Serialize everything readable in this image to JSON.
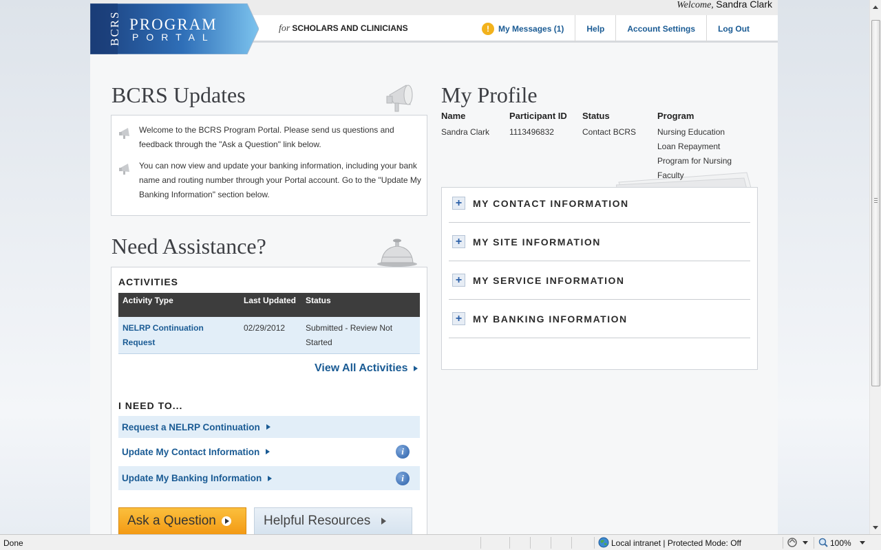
{
  "header": {
    "welcome_prefix": "Welcome,",
    "user_name": "Sandra Clark",
    "logo_abbr": "BCRS",
    "logo_line1": "PROGRAM",
    "logo_line2": "PORTAL",
    "tagline_for": "for",
    "tagline": "SCHOLARS AND CLINICIANS",
    "nav": {
      "messages": "My Messages (1)",
      "messages_alert": "!",
      "help": "Help",
      "account_settings": "Account Settings",
      "log_out": "Log Out"
    }
  },
  "updates": {
    "title": "BCRS Updates",
    "items": [
      "Welcome to the BCRS Program Portal. Please send us questions and feedback through the \"Ask a Question\" link below.",
      "You can now view and update your banking information, including your bank name and routing number through your Portal account. Go to the \"Update My Banking Information\" section below."
    ]
  },
  "assistance": {
    "title": "Need Assistance?",
    "activities_label": "ACTIVITIES",
    "columns": [
      "Activity Type",
      "Last Updated",
      "Status"
    ],
    "rows": [
      {
        "type": "NELRP Continuation Request",
        "updated": "02/29/2012",
        "status": "Submitted - Review Not Started"
      }
    ],
    "view_all": "View All Activities",
    "need_to_label": "I NEED TO...",
    "need_to": [
      "Request a NELRP Continuation",
      "Update My Contact Information",
      "Update My Banking Information"
    ],
    "info_glyph": "i",
    "ask_button": "Ask a Question",
    "resources_button": "Helpful Resources"
  },
  "profile": {
    "title": "My Profile",
    "headers": {
      "name": "Name",
      "participant_id": "Participant ID",
      "status": "Status",
      "program": "Program"
    },
    "values": {
      "name": "Sandra Clark",
      "participant_id": "1113496832",
      "status": "Contact BCRS",
      "program_lines": [
        "Nursing Education",
        "Loan Repayment",
        "Program for Nursing",
        "Faculty"
      ]
    },
    "sections": [
      "MY CONTACT INFORMATION",
      "MY SITE INFORMATION",
      "MY SERVICE INFORMATION",
      "MY BANKING INFORMATION"
    ],
    "expand_glyph": "+"
  },
  "statusbar": {
    "left": "Done",
    "zone": "Local intranet | Protected Mode: Off",
    "zoom": "100%"
  },
  "colors": {
    "link_blue": "#1a5b94",
    "logo_blue": "#1f4f93",
    "ask_orange": "#f39a14",
    "table_header": "#3d3d3d",
    "row_shade": "#e2eef8"
  },
  "icons": [
    "megaphone-icon",
    "service-bell-icon",
    "alert-icon",
    "info-icon",
    "plus-icon",
    "globe-icon",
    "zoom-icon"
  ]
}
